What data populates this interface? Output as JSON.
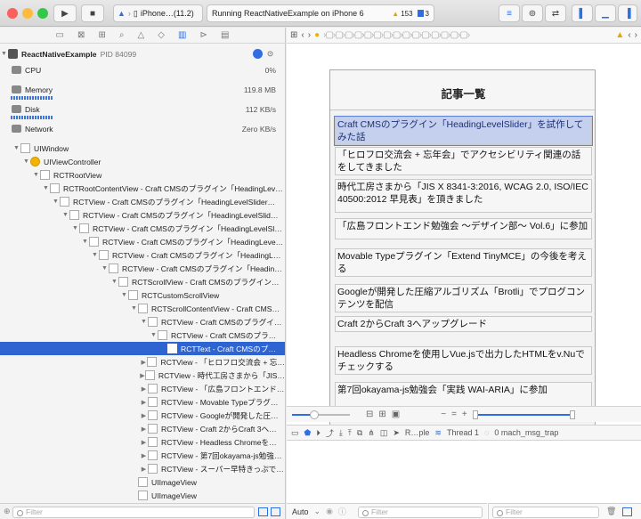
{
  "toolbar": {
    "scheme_target": "iPhone…(11.2)",
    "activity": "Running ReactNativeExample on iPhone 6",
    "warnings": "153",
    "issues": "3"
  },
  "process": {
    "name": "ReactNativeExample",
    "pid": "PID 84099"
  },
  "gauges": [
    {
      "label": "CPU",
      "value": "0%"
    },
    {
      "label": "Memory",
      "value": "119.8 MB"
    },
    {
      "label": "Disk",
      "value": "112 KB/s"
    },
    {
      "label": "Network",
      "value": "Zero KB/s"
    }
  ],
  "tree": [
    {
      "d": 0,
      "exp": "open",
      "label": "UIWindow"
    },
    {
      "d": 1,
      "exp": "open",
      "label": "UIViewController",
      "icon": "yellow"
    },
    {
      "d": 2,
      "exp": "open",
      "label": "RCTRootView"
    },
    {
      "d": 3,
      "exp": "open",
      "label": "RCTRootContentView - Craft CMSのプラグイン「HeadingLev…"
    },
    {
      "d": 4,
      "exp": "open",
      "label": "RCTView - Craft CMSのプラグイン「HeadingLevelSlider…"
    },
    {
      "d": 5,
      "exp": "open",
      "label": "RCTView - Craft CMSのプラグイン「HeadingLevelSlid…"
    },
    {
      "d": 6,
      "exp": "open",
      "label": "RCTView - Craft CMSのプラグイン「HeadingLevelSl…"
    },
    {
      "d": 7,
      "exp": "open",
      "label": "RCTView - Craft CMSのプラグイン「HeadingLeve…"
    },
    {
      "d": 8,
      "exp": "open",
      "label": "RCTView - Craft CMSのプラグイン「HeadingL…"
    },
    {
      "d": 9,
      "exp": "open",
      "label": "RCTView - Craft CMSのプラグイン「Headin…"
    },
    {
      "d": 10,
      "exp": "open",
      "label": "RCTScrollView - Craft CMSのプラグイン…"
    },
    {
      "d": 11,
      "exp": "open",
      "label": "RCTCustomScrollView"
    },
    {
      "d": 12,
      "exp": "open",
      "label": "RCTScrollContentView - Craft CMS…"
    },
    {
      "d": 13,
      "exp": "open",
      "label": "RCTView - Craft CMSのプラグイ…"
    },
    {
      "d": 14,
      "exp": "open",
      "label": "RCTView - Craft CMSのプラ…"
    },
    {
      "d": 15,
      "exp": "none",
      "label": "RCTText - Craft CMSのプ…",
      "selected": true
    },
    {
      "d": 13,
      "exp": "closed",
      "label": "RCTView - 「ヒロフロ交流会 + 忘…"
    },
    {
      "d": 13,
      "exp": "closed",
      "label": "RCTView - 時代工房さまから「JIS…"
    },
    {
      "d": 13,
      "exp": "closed",
      "label": "RCTView - 「広島フロントエンド…"
    },
    {
      "d": 13,
      "exp": "closed",
      "label": "RCTView - Movable Typeプラグ…"
    },
    {
      "d": 13,
      "exp": "closed",
      "label": "RCTView - Googleが開発した圧…"
    },
    {
      "d": 13,
      "exp": "closed",
      "label": "RCTView - Craft 2からCraft 3へ…"
    },
    {
      "d": 13,
      "exp": "closed",
      "label": "RCTView - Headless Chromeを…"
    },
    {
      "d": 13,
      "exp": "closed",
      "label": "RCTView - 第7回okayama-js勉強…"
    },
    {
      "d": 13,
      "exp": "closed",
      "label": "RCTView - スーパー早特きっぷで…"
    },
    {
      "d": 12,
      "exp": "none",
      "label": "UIImageView"
    },
    {
      "d": 12,
      "exp": "none",
      "label": "UIImageView"
    }
  ],
  "left_filter": "Filter",
  "screen": {
    "title": "記事一覧",
    "articles": [
      "Craft CMSのプラグイン「HeadingLevelSlider」を試作してみた話",
      "「ヒロフロ交流会 + 忘年会」でアクセシビリティ関連の話をしてきました",
      "時代工房さまから「JIS X 8341-3:2016, WCAG 2.0, ISO/IEC 40500:2012 早見表」を頂きました",
      "「広島フロントエンド勉強会 〜デザイン部〜 Vol.6」に参加",
      "Movable Typeプラグイン「Extend TinyMCE」の今後を考える",
      "Googleが開発した圧縮アルゴリズム「Brotli」でプログコンテンツを配信",
      "Craft 2からCraft 3へアップグレード",
      "Headless Chromeを使用しVue.jsで出力したHTMLをv.Nuでチェックする",
      "第7回okayama-js勉強会「実践 WAI-ARIA」に参加"
    ]
  },
  "debug": {
    "breadcrumb1": "R…ple",
    "thread": "Thread 1",
    "frame": "0 mach_msg_trap"
  },
  "bottom": {
    "auto": "Auto",
    "filter": "Filter"
  },
  "accent": "#2e63d2"
}
